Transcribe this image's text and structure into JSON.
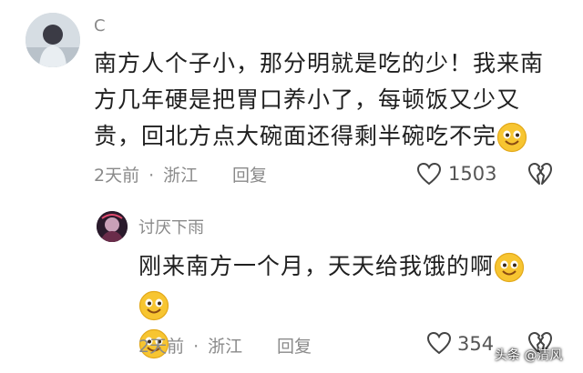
{
  "main_comment": {
    "username": "C",
    "text": "南方人个子小，那分明就是吃的少！我来南方几年硬是把胃口养小了，每顿饭又少又贵，回北方点大碗面还得剩半碗吃不完",
    "emoji": "smile-emoji",
    "time": "2天前",
    "location": "浙江",
    "reply_label": "回复",
    "like_count": "1503",
    "like_icon": "heart-icon",
    "dislike_icon": "broken-heart-icon"
  },
  "reply": {
    "username": "讨厌下雨",
    "text": "刚来南方一个月，天天给我饿的啊",
    "emojis": [
      "smile-emoji",
      "smile-emoji",
      "smile-emoji"
    ],
    "time": "2天前",
    "location": "浙江",
    "reply_label": "回复",
    "like_count": "354",
    "like_icon": "heart-icon",
    "dislike_icon": "broken-heart-icon"
  },
  "meta_separator": "·",
  "watermark": "头条 @清风",
  "colors": {
    "text": "#1f1f1f",
    "meta": "#8a8a8a",
    "emoji": "#f7c531",
    "background": "#ffffff"
  }
}
